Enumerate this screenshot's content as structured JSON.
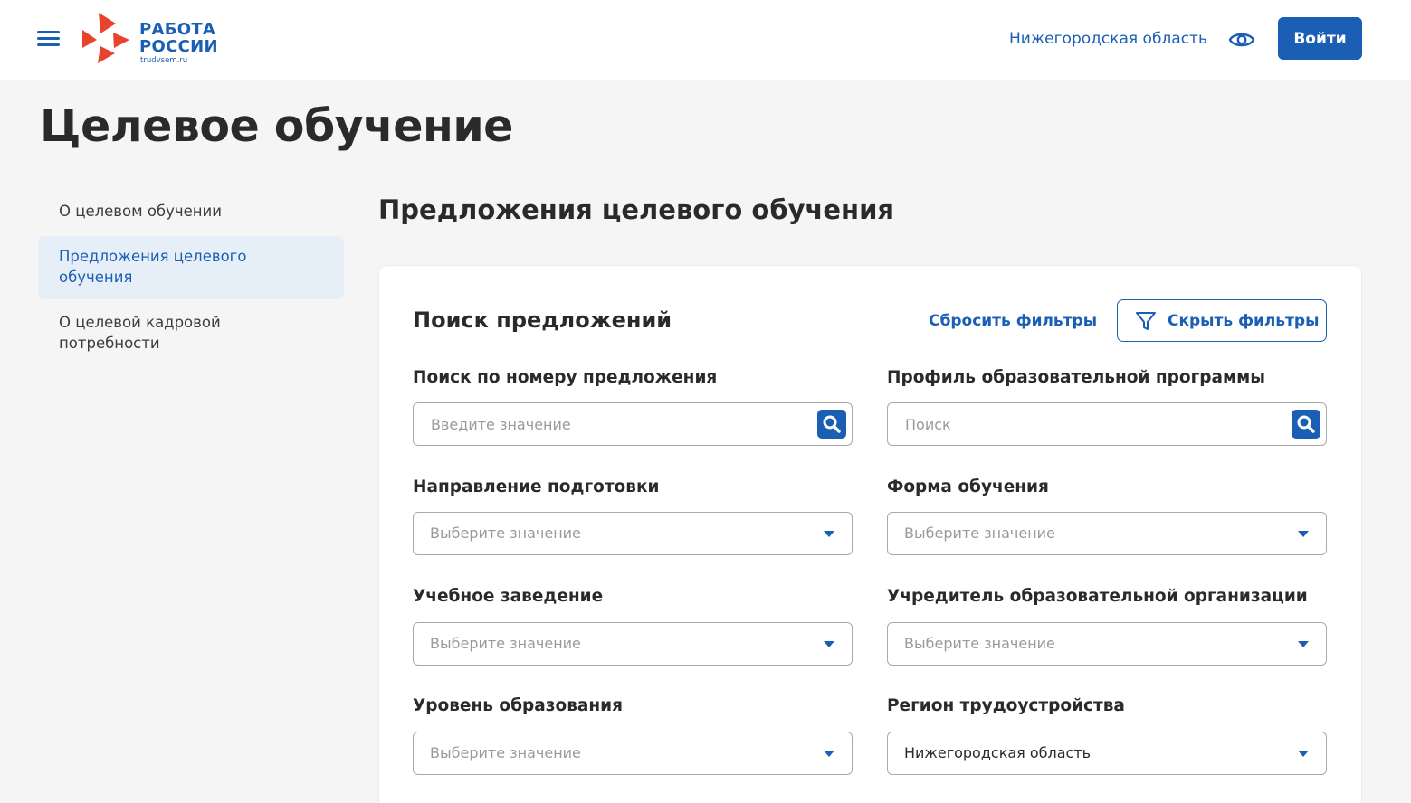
{
  "header": {
    "logo_line1": "РАБОТА",
    "logo_line2": "РОССИИ",
    "logo_site": "trudvsem.ru",
    "region": "Нижегородская область",
    "login_label": "Войти"
  },
  "page_title": "Целевое обучение",
  "sidebar": {
    "items": [
      {
        "label": "О целевом обучении",
        "active": false
      },
      {
        "label": "Предложения целевого обучения",
        "active": true
      },
      {
        "label": "О целевой кадровой потребности",
        "active": false
      }
    ]
  },
  "section_title": "Предложения целевого обучения",
  "search_card": {
    "title": "Поиск предложений",
    "reset_label": "Сбросить фильтры",
    "hide_label": "Скрыть фильтры",
    "fields": {
      "offer_number": {
        "label": "Поиск по номеру предложения",
        "placeholder": "Введите значение"
      },
      "program_profile": {
        "label": "Профиль образовательной программы",
        "placeholder": "Поиск"
      },
      "direction": {
        "label": "Направление подготовки",
        "value": "Выберите значение"
      },
      "study_form": {
        "label": "Форма обучения",
        "value": "Выберите значение"
      },
      "institution": {
        "label": "Учебное заведение",
        "value": "Выберите значение"
      },
      "founder": {
        "label": "Учредитель образовательной организации",
        "value": "Выберите значение"
      },
      "education_level": {
        "label": "Уровень образования",
        "value": "Выберите значение"
      },
      "employment_region": {
        "label": "Регион трудоустройства",
        "value": "Нижегородская область"
      }
    }
  },
  "colors": {
    "accent": "#1b5fb4",
    "logo_red": "#e8432c",
    "active_bg": "#e6eff8",
    "page_bg": "#f5f5f5"
  },
  "icons": [
    "menu-icon",
    "logo-arrows-icon",
    "eye-icon",
    "filter-icon",
    "search-icon",
    "chevron-down-icon"
  ]
}
